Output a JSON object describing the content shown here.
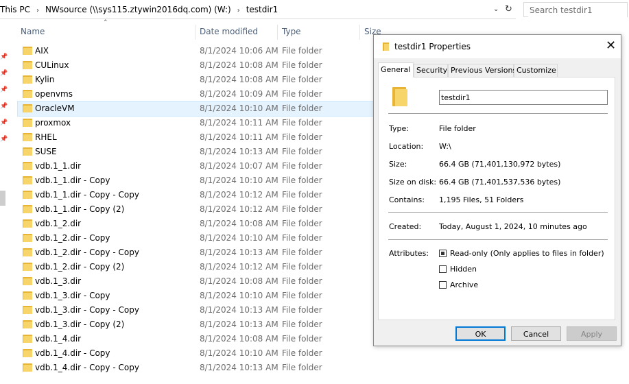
{
  "address": {
    "crumbs": [
      "This PC",
      "NWsource (\\\\sys115.ztywin2016dq.com) (W:)",
      "testdir1"
    ],
    "search_placeholder": "Search testdir1"
  },
  "icons": {
    "crumb_sep": "›",
    "dropdown": "⌄",
    "refresh": "↻",
    "sort_up": "⌃",
    "pin": "📌",
    "close": "✕"
  },
  "columns": {
    "name": "Name",
    "date": "Date modified",
    "type": "Type",
    "size": "Size"
  },
  "files": [
    {
      "name": "AIX",
      "date": "8/1/2024 10:06 AM",
      "type": "File folder"
    },
    {
      "name": "CULinux",
      "date": "8/1/2024 10:08 AM",
      "type": "File folder"
    },
    {
      "name": "Kylin",
      "date": "8/1/2024 10:08 AM",
      "type": "File folder"
    },
    {
      "name": "openvms",
      "date": "8/1/2024 10:09 AM",
      "type": "File folder"
    },
    {
      "name": "OracleVM",
      "date": "8/1/2024 10:10 AM",
      "type": "File folder",
      "hovered": true
    },
    {
      "name": "proxmox",
      "date": "8/1/2024 10:11 AM",
      "type": "File folder"
    },
    {
      "name": "RHEL",
      "date": "8/1/2024 10:11 AM",
      "type": "File folder"
    },
    {
      "name": "SUSE",
      "date": "8/1/2024 10:13 AM",
      "type": "File folder"
    },
    {
      "name": "vdb.1_1.dir",
      "date": "8/1/2024 10:07 AM",
      "type": "File folder"
    },
    {
      "name": "vdb.1_1.dir - Copy",
      "date": "8/1/2024 10:10 AM",
      "type": "File folder"
    },
    {
      "name": "vdb.1_1.dir - Copy - Copy",
      "date": "8/1/2024 10:12 AM",
      "type": "File folder"
    },
    {
      "name": "vdb.1_1.dir - Copy (2)",
      "date": "8/1/2024 10:12 AM",
      "type": "File folder"
    },
    {
      "name": "vdb.1_2.dir",
      "date": "8/1/2024 10:08 AM",
      "type": "File folder"
    },
    {
      "name": "vdb.1_2.dir - Copy",
      "date": "8/1/2024 10:10 AM",
      "type": "File folder"
    },
    {
      "name": "vdb.1_2.dir - Copy - Copy",
      "date": "8/1/2024 10:13 AM",
      "type": "File folder"
    },
    {
      "name": "vdb.1_2.dir - Copy (2)",
      "date": "8/1/2024 10:12 AM",
      "type": "File folder"
    },
    {
      "name": "vdb.1_3.dir",
      "date": "8/1/2024 10:08 AM",
      "type": "File folder"
    },
    {
      "name": "vdb.1_3.dir - Copy",
      "date": "8/1/2024 10:10 AM",
      "type": "File folder"
    },
    {
      "name": "vdb.1_3.dir - Copy - Copy",
      "date": "8/1/2024 10:13 AM",
      "type": "File folder"
    },
    {
      "name": "vdb.1_3.dir - Copy (2)",
      "date": "8/1/2024 10:13 AM",
      "type": "File folder"
    },
    {
      "name": "vdb.1_4.dir",
      "date": "8/1/2024 10:08 AM",
      "type": "File folder"
    },
    {
      "name": "vdb.1_4.dir - Copy",
      "date": "8/1/2024 10:10 AM",
      "type": "File folder"
    },
    {
      "name": "vdb.1_4.dir - Copy - Copy",
      "date": "8/1/2024 10:13 AM",
      "type": "File folder"
    }
  ],
  "dialog": {
    "title": "testdir1 Properties",
    "tabs": [
      "General",
      "Security",
      "Previous Versions",
      "Customize"
    ],
    "active_tab": "General",
    "folder_name": "testdir1",
    "props": {
      "type_label": "Type:",
      "type_value": "File folder",
      "location_label": "Location:",
      "location_value": "W:\\",
      "size_label": "Size:",
      "size_value": "66.4 GB (71,401,130,972 bytes)",
      "size_on_disk_label": "Size on disk:",
      "size_on_disk_value": "66.4 GB (71,401,537,536 bytes)",
      "contains_label": "Contains:",
      "contains_value": "1,195 Files, 51 Folders",
      "created_label": "Created:",
      "created_value": "Today, August 1, 2024, 10 minutes ago",
      "attributes_label": "Attributes:"
    },
    "attributes": {
      "readonly_label": "Read-only (Only applies to files in folder)",
      "readonly_checked": true,
      "hidden_label": "Hidden",
      "hidden_checked": false,
      "archive_label": "Archive",
      "archive_checked": false
    },
    "buttons": {
      "ok": "OK",
      "cancel": "Cancel",
      "apply": "Apply"
    }
  },
  "colors": {
    "folder_back": "#e8b436",
    "folder_front": "#f7d56b",
    "hover_row": "#e5f3ff",
    "header_text": "#4c607a",
    "default_button_border": "#0078d7"
  }
}
